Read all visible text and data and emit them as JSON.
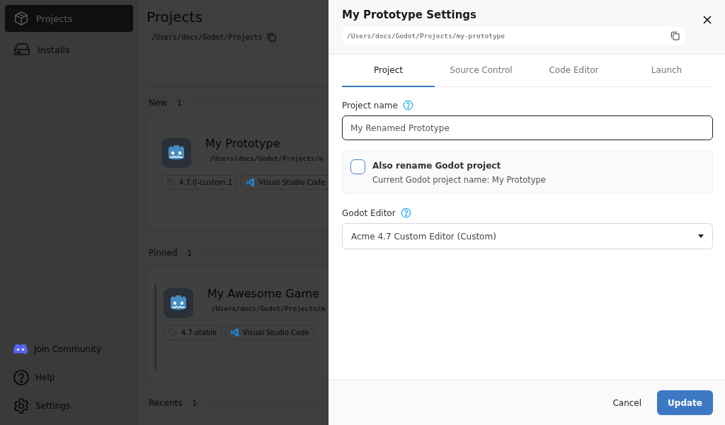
{
  "sidebar": {
    "items": [
      {
        "kind": "box",
        "label": "Projects",
        "selected": true
      },
      {
        "kind": "drive",
        "label": "Installs",
        "selected": false
      }
    ],
    "footer_items": [
      {
        "kind": "community",
        "label": "Join Community"
      },
      {
        "kind": "help",
        "label": "Help"
      },
      {
        "kind": "settings",
        "label": "Settings"
      }
    ]
  },
  "main": {
    "title": "Projects",
    "path": "/Users/docs/Godot/Projects",
    "sections": [
      {
        "label": "New",
        "count": "1",
        "cards": [
          {
            "name": "My Prototype",
            "path": "/Users/docs/Godot/Projects/m",
            "tags": [
              {
                "kind": "version",
                "label": "4.7.0-custom.1"
              },
              {
                "kind": "editor",
                "label": "Visual Studio Code"
              }
            ]
          }
        ]
      },
      {
        "label": "Pinned",
        "count": "1",
        "cards": [
          {
            "name": "My Awesome Game",
            "path": "/Users/docs/Godot/Projects/m",
            "tags": [
              {
                "kind": "version",
                "label": "4.7-stable"
              },
              {
                "kind": "editor",
                "label": "Visual Studio Code"
              }
            ]
          }
        ]
      },
      {
        "label": "Recents",
        "count": "1"
      }
    ]
  },
  "drawer": {
    "title": "My Prototype Settings",
    "path": "/Users/docs/Godot/Projects/my-prototype",
    "tabs": [
      {
        "label": "Project",
        "selected": true
      },
      {
        "label": "Source Control",
        "selected": false
      },
      {
        "label": "Code Editor",
        "selected": false
      },
      {
        "label": "Launch",
        "selected": false
      }
    ],
    "fields": [
      {
        "kind": "text",
        "label": "Project name",
        "value": "My Renamed Prototype"
      },
      {
        "kind": "checkbox",
        "label": "Also rename Godot project",
        "description": "Current Godot project name: My Prototype",
        "checked": false
      },
      {
        "kind": "select",
        "label": "Godot Editor",
        "value": "Acme 4.7 Custom Editor (Custom)"
      }
    ],
    "buttons": [
      {
        "kind": "secondary",
        "label": "Cancel"
      },
      {
        "kind": "primary",
        "label": "Update"
      }
    ]
  }
}
